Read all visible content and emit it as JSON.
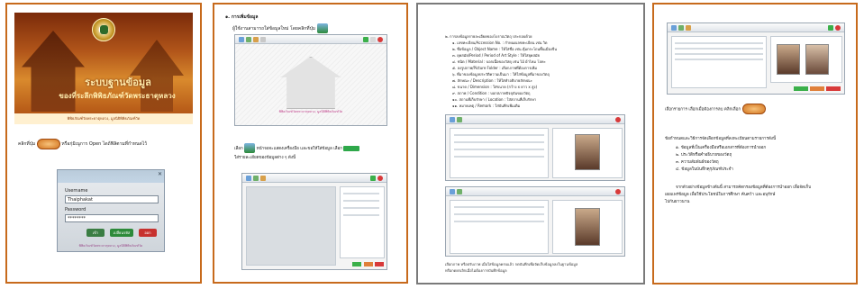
{
  "page1": {
    "cover_title": "ระบบฐานข้อมูล",
    "cover_subtitle": "ของที่ระลึกพิพิธภัณฑ์วัดพระธาตุหลวง",
    "cover_footer": "พิพิธภัณฑ์วัดพระธาตุหลวง, มูลนิธิพิพิธภัณฑ์วัด",
    "instruction_prefix": "คลิกที่ปุ่ม",
    "instruction_suffix": "หรือกุ่มิเนูการ Open ไดถ้ฟิลิตามที่กำหนดไว้",
    "login": {
      "username_label": "Username",
      "username_value": "Thaiphakat",
      "password_label": "Password",
      "password_value": "********",
      "btn_login": "เข้า",
      "btn_change": "เปลี่ยนรหัส",
      "btn_exit": "ออก",
      "footer": "พิพิธภัณฑ์วัดพระธาตุหลวง, มูลนิธิพิพิธภัณฑ์วัด"
    }
  },
  "page2": {
    "heading": "๑. การเพิ่มข้อมูล",
    "subheading": "ผู้ใช้งานสามารถใส่ข้อมูลใหม่ โดยคลิกที่ปุ่ม",
    "screen_caption": "พิพิธภัณฑ์วัดพระธาตุหลวง, มูลนิธิพิพิธภัณฑ์วัด",
    "mid_line1_a": "เลือก",
    "mid_line1_b": "หน้าจอจะแสดงเครื่องมือ และขอให้ใส่ข้อมูล เลือก",
    "mid_line2": "ใส่รายละเอียดของข้อมูลต่าง ๆ ดังนี้"
  },
  "page3": {
    "intro": "๒. การลงข้อมูลรายละเอียดของโบราณวัตถุ ประกอบด้วย",
    "items": [
      "๑. เลขทะเบียน/Accession No. : กำหนดเลขทะเบียน เช่น วิด",
      "๒. ชื่อข้อมูล / Object Name : ให้ใส่ชื่อ เช่น ตุ้มกระโถนพื้นเมืองจีน",
      "๓. ยุคสมัย/Period / Period of Art Style : ให้ใส่ยุคสมัย",
      "๔. ชนิด / Material : บอกเนื้อของวัสดุ เช่น ไม้ ผ้าไหม โลหะ",
      "๕. ลงรูปภาพ/Picture Folder : เลือกภาพที่ต้องการเพิ่ม"
    ],
    "items2": [
      "๖. ที่มาของข้อมูลประวัติความเป็นมา : ให้ใส่ข้อมูลที่มาของวัตถุ",
      "๗. ลักษณะ / Description : ให้ใส่คำอธิบายลักษณะ",
      "๘. ขนาด / Dimension : ใส่ขนาด (กว้าง x ยาว x สูง)",
      "๙. สภาพ / Condition : บอกสภาพปัจจุบันของวัตถุ",
      "๑๐. สถานที่เก็บรักษา / Location : ใส่สถานที่เก็บรักษา",
      "๑๑. หมายเหตุ / Remark : ใส่บันทึกเพิ่มเติม"
    ],
    "footer_line1": "เลือกภาพ หรือปรับภาพ เมื่อใส่ข้อมูลครบแล้ว กดบันทึกเพื่อจัดเก็บข้อมูลลงในฐานข้อมูล",
    "footer_line2": "หรือกดยกเลิกเมื่อไม่ต้องการบันทึกข้อมูล"
  },
  "page4": {
    "caption": "เลือกรายการ เลือกเมื่อต้องการลบ คลิกเลือก",
    "para1": "ข้อกำหนดและวิธีการจัดเลือกข้อมูลที่ลงทะเบียนตามรายการดังนี้",
    "bullets": [
      "๑. ข้อมูลที่เป็นเครื่องมือหรือเอกสารที่ต้องการนำออก",
      "๒. ประวัติหรือคำอธิบายของวัตถุ",
      "๓. ความสัมพันธ์ของวัตถุ",
      "๔. ข้อมูลในบันทึกคุรุภัณฑ์ประจำ"
    ],
    "para2_line1": "จากตัวอย่างข้อมูลข้างต้นนี้ สามารถคัดกรองข้อมูลที่ต้องการนำออก เพื่อจัดเก็บ",
    "para2_line2": "เผยแพร่ข้อมูล เพื่อใช้ประโยชน์ในการศึกษา ค้นคว้า และอนุรักษ์",
    "para2_line3": "ไปกันยาวนาน"
  }
}
